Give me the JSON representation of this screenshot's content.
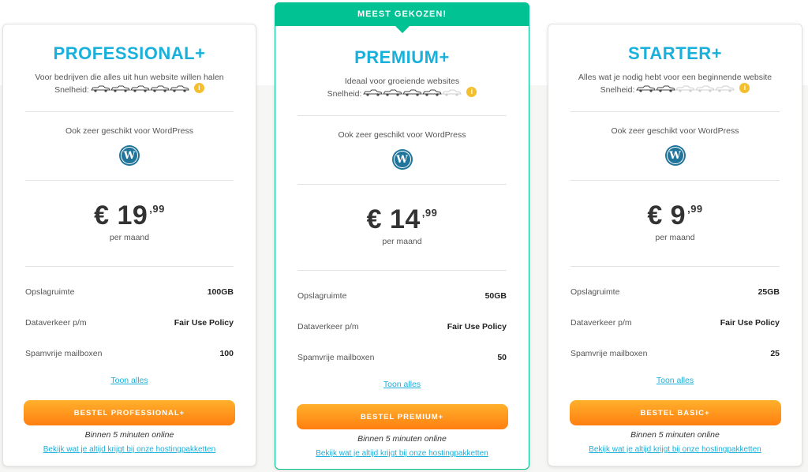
{
  "cards": [
    {
      "title": "PROFESSIONAL+",
      "tagline": "Voor bedrijven die alles uit hun website willen halen",
      "speed_label": "Snelheid:",
      "speed_level": 5,
      "speed_max": 5,
      "info": "i",
      "wp_text": "Ook zeer geschikt voor WordPress",
      "price_main": "€ 19",
      "price_cents": ",99",
      "period": "per maand",
      "specs": [
        {
          "label": "Opslagruimte",
          "value": "100GB"
        },
        {
          "label": "Dataverkeer p/m",
          "value": "Fair Use Policy"
        },
        {
          "label": "Spamvrije mailboxen",
          "value": "100"
        }
      ],
      "toon": "Toon alles",
      "order": "BESTEL PROFESSIONAL+",
      "online": "Binnen 5 minuten online",
      "bekijk": "Bekijk wat je altijd krijgt bij onze hostingpakketten"
    },
    {
      "ribbon": "MEEST GEKOZEN!",
      "title": "PREMIUM+",
      "tagline": "Ideaal voor groeiende websites",
      "speed_label": "Snelheid:",
      "speed_level": 4,
      "speed_max": 5,
      "info": "i",
      "wp_text": "Ook zeer geschikt voor WordPress",
      "price_main": "€ 14",
      "price_cents": ",99",
      "period": "per maand",
      "specs": [
        {
          "label": "Opslagruimte",
          "value": "50GB"
        },
        {
          "label": "Dataverkeer p/m",
          "value": "Fair Use Policy"
        },
        {
          "label": "Spamvrije mailboxen",
          "value": "50"
        }
      ],
      "toon": "Toon alles",
      "order": "BESTEL PREMIUM+",
      "online": "Binnen 5 minuten online",
      "bekijk": "Bekijk wat je altijd krijgt bij onze hostingpakketten"
    },
    {
      "title": "STARTER+",
      "tagline": "Alles wat je nodig hebt voor een beginnende website",
      "speed_label": "Snelheid:",
      "speed_level": 2,
      "speed_max": 5,
      "info": "i",
      "wp_text": "Ook zeer geschikt voor WordPress",
      "price_main": "€ 9",
      "price_cents": ",99",
      "period": "per maand",
      "specs": [
        {
          "label": "Opslagruimte",
          "value": "25GB"
        },
        {
          "label": "Dataverkeer p/m",
          "value": "Fair Use Policy"
        },
        {
          "label": "Spamvrije mailboxen",
          "value": "25"
        }
      ],
      "toon": "Toon alles",
      "order": "BESTEL BASIC+",
      "online": "Binnen 5 minuten online",
      "bekijk": "Bekijk wat je altijd krijgt bij onze hostingpakketten"
    }
  ],
  "colors": {
    "accent": "#1ab0dc",
    "ribbon": "#00c293",
    "button_top": "#ffb02c",
    "button_bottom": "#ff7f10",
    "info": "#f3bf2e",
    "wordpress": "#21759b"
  },
  "icons": {
    "speed": "race-car-icon",
    "info": "info-icon",
    "wordpress": "wordpress-logo-icon"
  }
}
